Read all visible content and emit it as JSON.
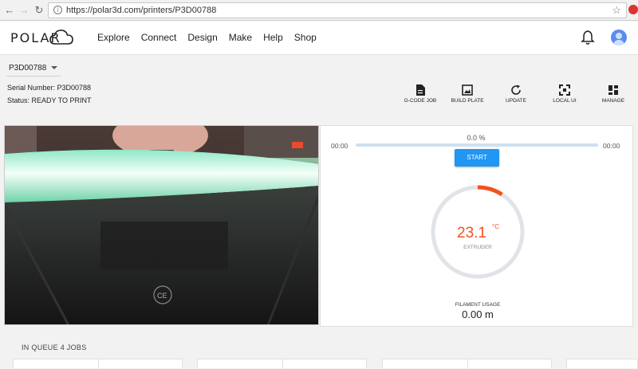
{
  "browser": {
    "url": "https://polar3d.com/printers/P3D00788"
  },
  "header": {
    "logo_text": "POLAR",
    "nav": [
      "Explore",
      "Connect",
      "Design",
      "Make",
      "Help",
      "Shop"
    ]
  },
  "printer": {
    "selected": "P3D00788",
    "serial_text": "Serial Number: P3D00788",
    "status_text": "Status: READY TO PRINT"
  },
  "actions": [
    {
      "label": "G-CODE JOB",
      "icon": "document-icon"
    },
    {
      "label": "BUILD PLATE",
      "icon": "image-frame-icon"
    },
    {
      "label": "UPDATE",
      "icon": "refresh-icon"
    },
    {
      "label": "LOCAL UI",
      "icon": "fullscreen-icon"
    },
    {
      "label": "MANAGE",
      "icon": "dashboard-icon"
    }
  ],
  "print": {
    "elapsed": "00:00",
    "remaining": "00:00",
    "progress_text": "0.0 %",
    "progress": 0,
    "start_label": "START"
  },
  "extruder": {
    "temperature": "23.1",
    "unit": "°C",
    "label": "EXTRUDER"
  },
  "filament": {
    "label": "FILAMENT USAGE",
    "value": "0.00 m"
  },
  "queue": {
    "title": "IN QUEUE 4 JOBS"
  },
  "colors": {
    "accent": "#2196f3",
    "temperature": "#f4511e",
    "gauge_track": "#e0e3e8"
  }
}
